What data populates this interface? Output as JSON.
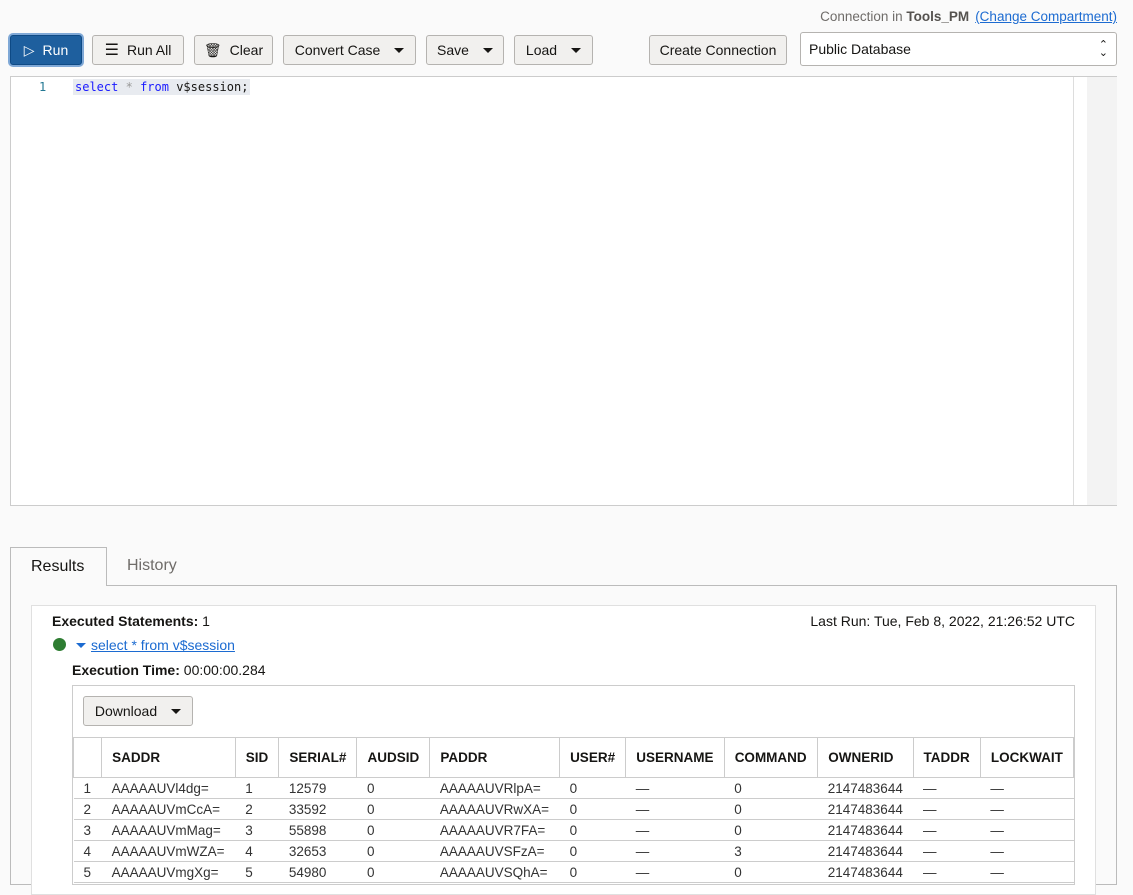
{
  "toolbar": {
    "run": "Run",
    "run_all": "Run All",
    "clear": "Clear",
    "convert_case": "Convert Case",
    "save": "Save",
    "load": "Load",
    "create_connection": "Create Connection"
  },
  "connection": {
    "prefix": "Connection in",
    "compartment": "Tools_PM",
    "change_link": "(Change Compartment)",
    "selected": "Public Database"
  },
  "editor": {
    "line": "1",
    "kw1": "select",
    "star": "*",
    "kw2": "from",
    "rest": "v$session;"
  },
  "tabs": {
    "results": "Results",
    "history": "History"
  },
  "results": {
    "executed_label": "Executed Statements:",
    "executed_count": "1",
    "last_run": "Last Run: Tue, Feb 8, 2022, 21:26:52 UTC",
    "statement": "select * from v$session",
    "exec_label": "Execution Time:",
    "exec_time": "00:00:00.284",
    "download": "Download",
    "status_color": "#2e7d32"
  },
  "table": {
    "columns": [
      "",
      "SADDR",
      "SID",
      "SERIAL#",
      "AUDSID",
      "PADDR",
      "USER#",
      "USERNAME",
      "COMMAND",
      "OWNERID",
      "TADDR",
      "LOCKWAIT"
    ],
    "rows": [
      [
        "1",
        "AAAAAUVl4dg=",
        "1",
        "12579",
        "0",
        "AAAAAUVRlpA=",
        "0",
        "—",
        "0",
        "2147483644",
        "—",
        "—"
      ],
      [
        "2",
        "AAAAAUVmCcA=",
        "2",
        "33592",
        "0",
        "AAAAAUVRwXA=",
        "0",
        "—",
        "0",
        "2147483644",
        "—",
        "—"
      ],
      [
        "3",
        "AAAAAUVmMag=",
        "3",
        "55898",
        "0",
        "AAAAAUVR7FA=",
        "0",
        "—",
        "0",
        "2147483644",
        "—",
        "—"
      ],
      [
        "4",
        "AAAAAUVmWZA=",
        "4",
        "32653",
        "0",
        "AAAAAUVSFzA=",
        "0",
        "—",
        "3",
        "2147483644",
        "—",
        "—"
      ],
      [
        "5",
        "AAAAAUVmgXg=",
        "5",
        "54980",
        "0",
        "AAAAAUVSQhA=",
        "0",
        "—",
        "0",
        "2147483644",
        "—",
        "—"
      ]
    ]
  }
}
